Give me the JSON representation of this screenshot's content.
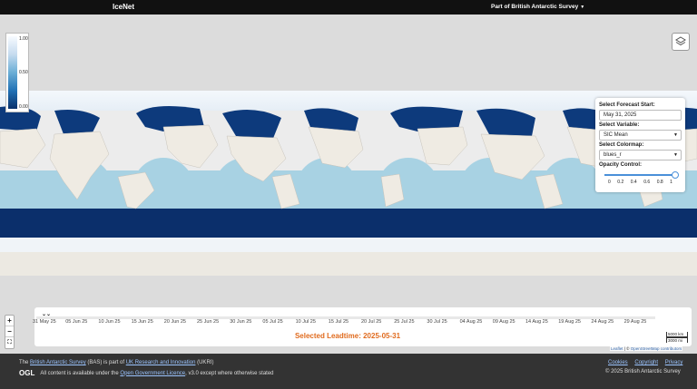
{
  "header": {
    "brand": "IceNet",
    "org_menu": "Part of British Antarctic Survey"
  },
  "legend": {
    "max": "1.00",
    "mid": "0.50",
    "min": "0.00"
  },
  "controls": {
    "forecast_start_label": "Select Forecast Start:",
    "forecast_start_value": "May 31, 2025",
    "variable_label": "Select Variable:",
    "variable_value": "SIC Mean",
    "colormap_label": "Select Colormap:",
    "colormap_value": "blues_r",
    "opacity_label": "Opacity Control:",
    "opacity_ticks": [
      "0",
      "0.2",
      "0.4",
      "0.6",
      "0.8",
      "1"
    ],
    "opacity_value": 1
  },
  "timeline": {
    "dates": [
      "31 May 25",
      "05 Jun 25",
      "10 Jun 25",
      "15 Jun 25",
      "20 Jun 25",
      "25 Jun 25",
      "30 Jun 25",
      "05 Jul 25",
      "10 Jul 25",
      "15 Jul 25",
      "20 Jul 25",
      "25 Jul 25",
      "30 Jul 25",
      "04 Aug 25",
      "09 Aug 25",
      "14 Aug 25",
      "19 Aug 25",
      "24 Aug 25",
      "29 Aug 25"
    ],
    "selected": "Selected Leadtime: 2025-05-31"
  },
  "zoom": {
    "in": "+",
    "out": "−",
    "fullscreen": "⛶"
  },
  "scale": {
    "km": "5000 km",
    "mi": "3000 mi"
  },
  "attribution": {
    "leaflet": "Leaflet",
    "sep": " | © ",
    "osm": "OpenStreetMap contributors"
  },
  "footer": {
    "line1_a": "The ",
    "bas_link": "British Antarctic Survey",
    "line1_b": " (BAS) is part of ",
    "ukri_link": "UK Research and Innovation",
    "line1_c": " (UKRI)",
    "ogl": "OGL",
    "line2_a": "All content is available under the ",
    "ogl_link": "Open Government Licence",
    "line2_b": ", v3.0 except where otherwise stated",
    "cookies": "Cookies",
    "copyright": "Copyright",
    "privacy": "Privacy",
    "copyright_line": "2025 British Antarctic Survey"
  }
}
